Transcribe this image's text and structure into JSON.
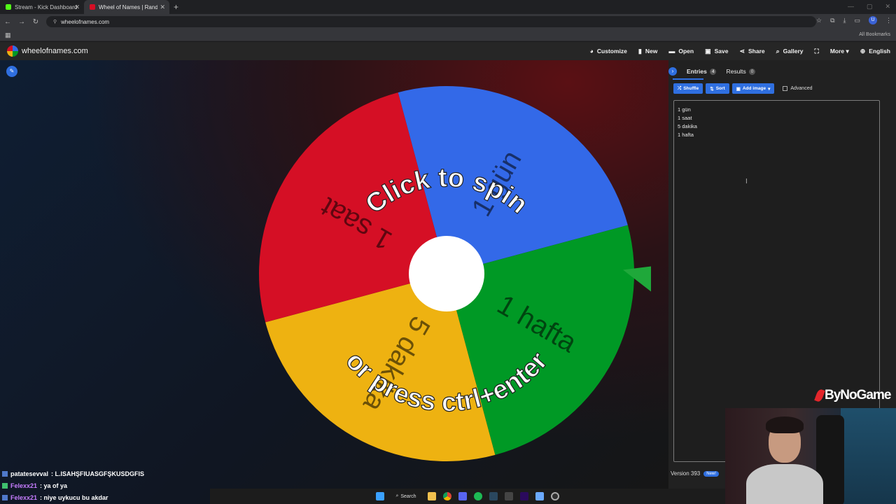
{
  "browser": {
    "tabs": [
      {
        "label": "Stream - Kick Dashboard",
        "favicon_color": "#53fc18"
      },
      {
        "label": "Wheel of Names | Random nam",
        "favicon_color": "#d50f25"
      }
    ],
    "url": "wheelofnames.com",
    "all_bookmarks": "All Bookmarks",
    "profile_initial": "U"
  },
  "site": {
    "name": "wheelofnames.com",
    "menu": [
      {
        "icon": "palette-icon",
        "glyph": "◕",
        "label": "Customize"
      },
      {
        "icon": "new-file-icon",
        "glyph": "▮",
        "label": "New"
      },
      {
        "icon": "folder-icon",
        "glyph": "▬",
        "label": "Open"
      },
      {
        "icon": "save-icon",
        "glyph": "▣",
        "label": "Save"
      },
      {
        "icon": "share-icon",
        "glyph": "⋖",
        "label": "Share"
      },
      {
        "icon": "search-icon",
        "glyph": "⌕",
        "label": "Gallery"
      },
      {
        "icon": "fullscreen-icon",
        "glyph": "⛶",
        "label": ""
      },
      {
        "icon": "more-icon",
        "glyph": "",
        "label": "More ▾"
      },
      {
        "icon": "globe-icon",
        "glyph": "⊕",
        "label": "English"
      }
    ]
  },
  "wheel": {
    "prompt_line1": "Click to spin",
    "prompt_line2": "or press ctrl+enter",
    "segments": [
      {
        "label": "1 gün",
        "color": "#3369e8"
      },
      {
        "label": "1 hafta",
        "color": "#009925"
      },
      {
        "label": "5 dakika",
        "color": "#eeb211"
      },
      {
        "label": "1 saat",
        "color": "#d50f25"
      }
    ]
  },
  "panel": {
    "tabs": [
      {
        "label": "Entries",
        "count": "4"
      },
      {
        "label": "Results",
        "count": "0"
      }
    ],
    "tools": {
      "shuffle": "Shuffle",
      "sort": "Sort",
      "add_image": "Add image",
      "advanced": "Advanced"
    },
    "entries": [
      "1 gün",
      "1 saat",
      "5 dakika",
      "1 hafta"
    ],
    "version": "Version 393",
    "new_badge": "New!"
  },
  "chat": [
    {
      "user": "patatesevval",
      "message": "L.ISAHŞFIUASGFŞKUSDGFIS",
      "user_color": "#ffffff"
    },
    {
      "user": "Felexx21",
      "message": "ya of ya",
      "user_color": "#c77dff"
    },
    {
      "user": "Felexx21",
      "message": "niye uykucu bu akdar",
      "user_color": "#c77dff"
    }
  ],
  "overlay": {
    "watermark": "ByNoGame"
  },
  "taskbar": {
    "search_label": "Search"
  }
}
